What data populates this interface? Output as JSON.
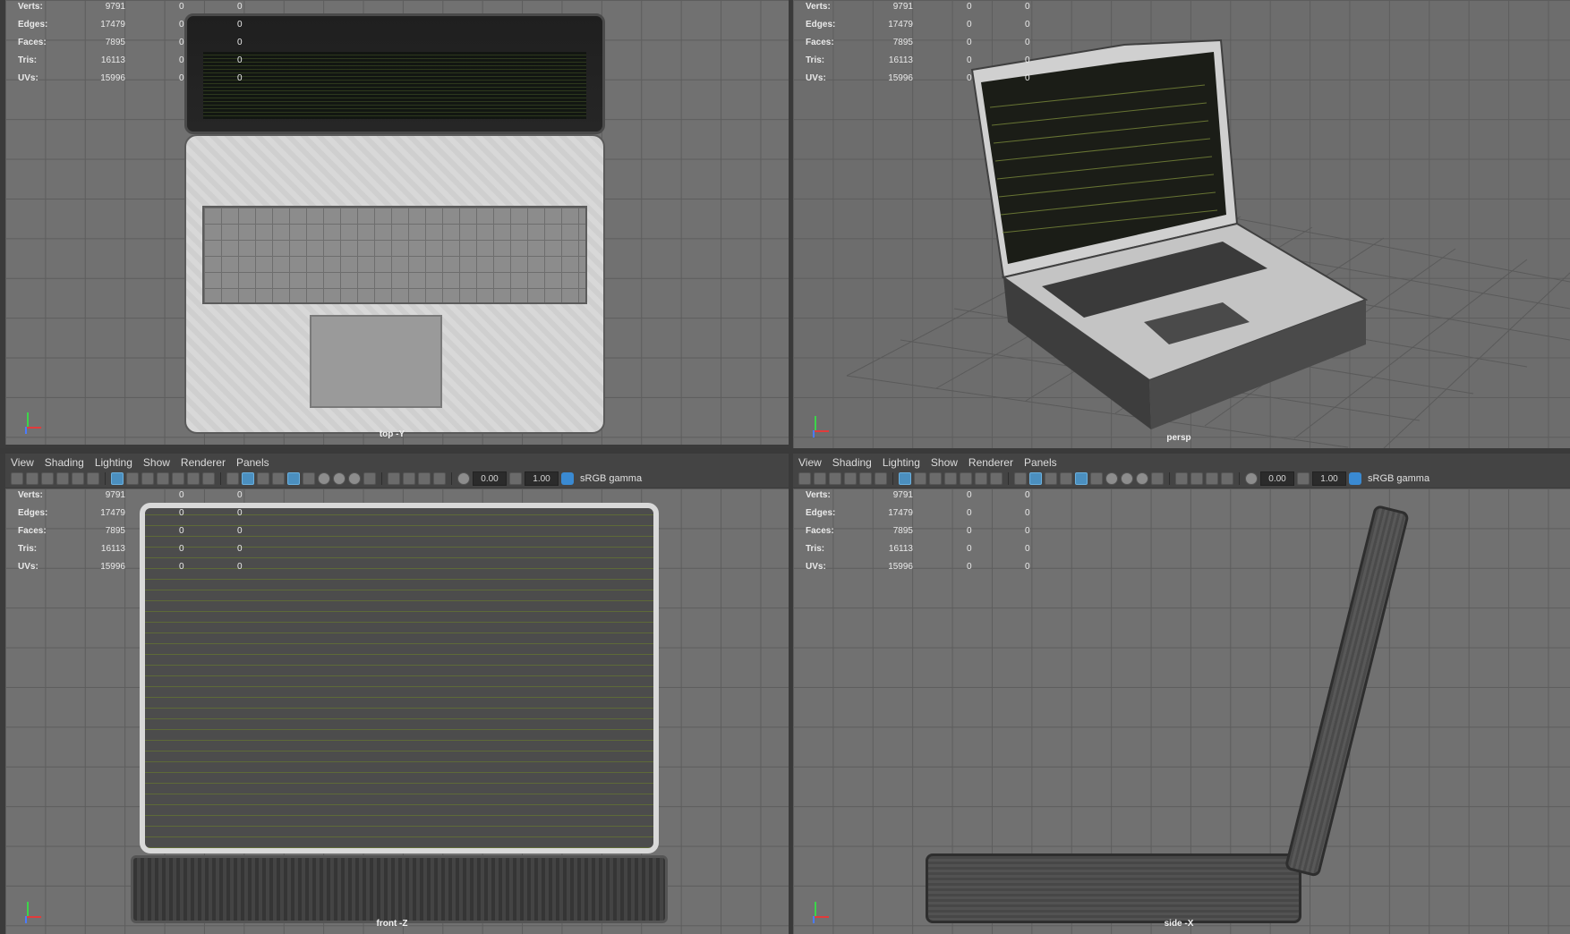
{
  "viewports": {
    "top": {
      "camera": "top -Y"
    },
    "persp": {
      "camera": "persp"
    },
    "front": {
      "camera": "front -Z"
    },
    "side": {
      "camera": "side -X"
    }
  },
  "stats": [
    {
      "label": "Verts:",
      "value": "9791",
      "z1": "0",
      "z2": "0"
    },
    {
      "label": "Edges:",
      "value": "17479",
      "z1": "0",
      "z2": "0"
    },
    {
      "label": "Faces:",
      "value": "7895",
      "z1": "0",
      "z2": "0"
    },
    {
      "label": "Tris:",
      "value": "16113",
      "z1": "0",
      "z2": "0"
    },
    {
      "label": "UVs:",
      "value": "15996",
      "z1": "0",
      "z2": "0"
    }
  ],
  "panel_menu": [
    "View",
    "Shading",
    "Lighting",
    "Show",
    "Renderer",
    "Panels"
  ],
  "toolbar": {
    "exposure": "0.00",
    "gamma": "1.00",
    "colorspace": "sRGB gamma"
  },
  "icons": {
    "camera": "camera-icon",
    "grid": "grid-toggle-icon",
    "wireframe": "wireframe-icon",
    "smooth_shade": "smooth-shade-icon",
    "exposure": "exposure-icon",
    "gamma": "gamma-icon",
    "colorspace": "colorspace-icon"
  },
  "colors": {
    "viewport_bg": "#717171",
    "grid_line": "#5d5d5d",
    "active_icon": "#4b8fbf",
    "axis_x": "#e23b3b",
    "axis_y": "#3cd54a",
    "axis_z": "#4a7bff"
  }
}
